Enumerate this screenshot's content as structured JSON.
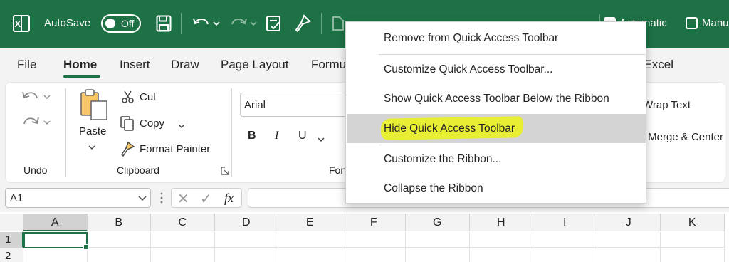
{
  "titlebar": {
    "autosave_label": "AutoSave",
    "autosave_state": "Off",
    "calc_mode_auto": "Automatic",
    "calc_mode_manual": "Manual",
    "bg_color": "#1e7145"
  },
  "tabs": [
    {
      "label": "File"
    },
    {
      "label": "Home"
    },
    {
      "label": "Insert"
    },
    {
      "label": "Draw"
    },
    {
      "label": "Page Layout"
    },
    {
      "label": "Formulas"
    },
    {
      "label": "Excel"
    }
  ],
  "ribbon": {
    "undo_group": "Undo",
    "clipboard_group": "Clipboard",
    "font_group": "Font",
    "paste": "Paste",
    "cut": "Cut",
    "copy": "Copy",
    "format_painter": "Format Painter",
    "font_name": "Arial",
    "bold": "B",
    "italic": "I",
    "underline": "U",
    "wrap_text": "Wrap Text",
    "merge_center": "Merge & Center"
  },
  "formula_bar": {
    "name_box": "A1",
    "fx": "fx",
    "cancel": "✕",
    "enter": "✓",
    "value": ""
  },
  "grid": {
    "columns": [
      "A",
      "B",
      "C",
      "D",
      "E",
      "F",
      "G",
      "H",
      "I",
      "J",
      "K"
    ],
    "rows": [
      "1",
      "2"
    ],
    "active_cell": "A1"
  },
  "context_menu": {
    "items": [
      {
        "label": "Remove from Quick Access Toolbar",
        "highlighted": false
      },
      {
        "label": "Customize Quick Access Toolbar...",
        "highlighted": false
      },
      {
        "label": "Show Quick Access Toolbar Below the Ribbon",
        "highlighted": false
      },
      {
        "label": "Hide Quick Access Toolbar",
        "highlighted": true
      },
      {
        "label": "Customize the Ribbon...",
        "highlighted": false
      },
      {
        "label": "Collapse the Ribbon",
        "highlighted": false
      }
    ],
    "highlight_color": "#e9ef2a"
  }
}
